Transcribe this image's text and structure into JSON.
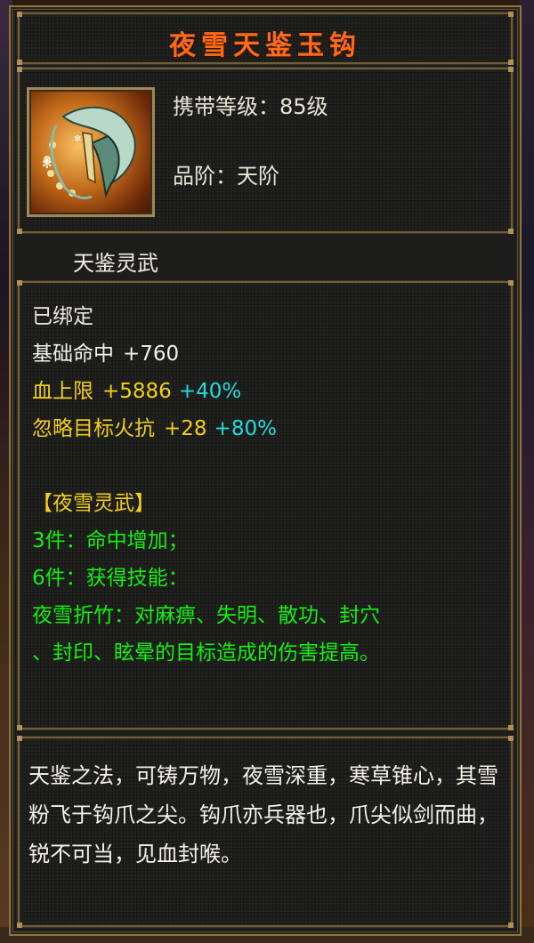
{
  "tooltip": {
    "title": "夜雪天鉴玉钩",
    "item_icon": "jade-hook-claw-weapon-icon",
    "carry_level": "携带等级：85级",
    "grade": "品阶：天阶",
    "category": "天鉴灵武",
    "bound": "已绑定",
    "stats": {
      "hit_label": "基础命中",
      "hit_value": "+760",
      "hp_label": "血上限",
      "hp_value": "+5886",
      "hp_bonus": "+40%",
      "fire_label": "忽略目标火抗",
      "fire_value": "+28",
      "fire_bonus": "+80%"
    },
    "set": {
      "name": "【夜雪灵武】",
      "piece3": "3件：命中增加；",
      "piece6": "6件：获得技能：",
      "skill_line1": "夜雪折竹：对麻痹、失明、散功、封穴",
      "skill_line2": "、封印、眩晕的目标造成的伤害提高。"
    },
    "description": "天鉴之法，可铸万物，夜雪深重，寒草锥心，其雪粉飞于钩爪之尖。钩爪亦兵器也，爪尖似剑而曲，锐不可当，见血封喉。"
  },
  "colors": {
    "title": "#ff6a1a",
    "stat_white": "#f2f2ec",
    "stat_yellow": "#f2d018",
    "stat_cyan": "#20dcdc",
    "set_green": "#14f010"
  }
}
